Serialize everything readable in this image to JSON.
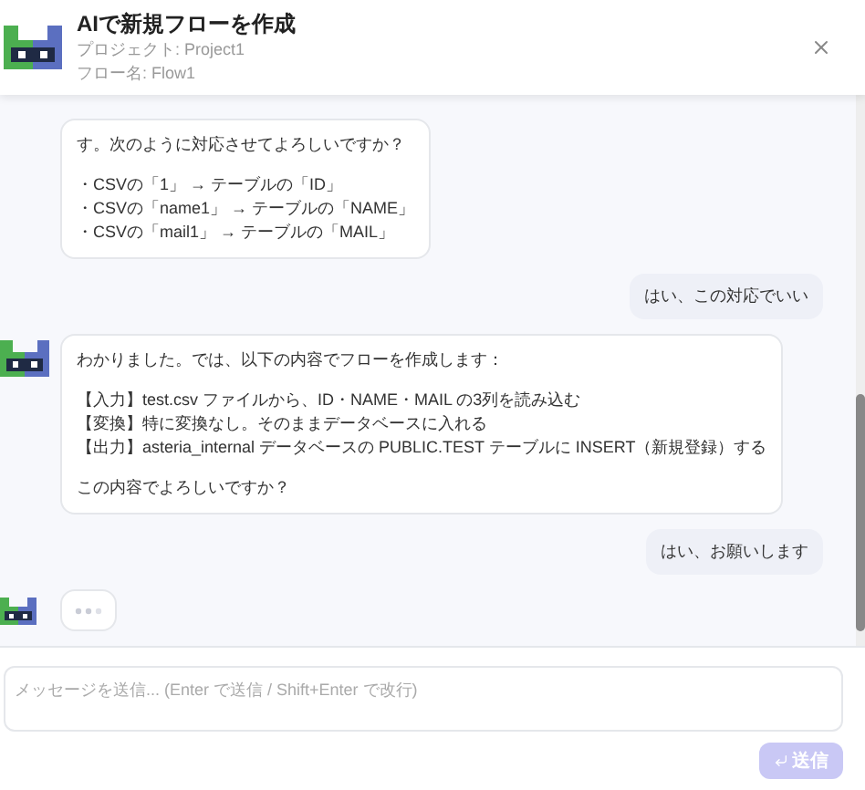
{
  "header": {
    "title": "AIで新規フローを作成",
    "project": "プロジェクト: Project1",
    "flow": "フロー名: Flow1"
  },
  "messages": [
    {
      "kind": "bot",
      "paragraphs": [
        [
          "す。次のように対応させてよろしいですか？"
        ],
        [
          "・CSVの「1」 → テーブルの「ID」",
          "・CSVの「name1」 → テーブルの「NAME」",
          "・CSVの「mail1」 → テーブルの「MAIL」"
        ]
      ],
      "avatar": false
    },
    {
      "kind": "user",
      "paragraphs": [
        [
          "はい、この対応でいい"
        ]
      ]
    },
    {
      "kind": "bot",
      "avatar": true,
      "paragraphs": [
        [
          "わかりました。では、以下の内容でフローを作成します："
        ],
        [
          "【入力】test.csv ファイルから、ID・NAME・MAIL の3列を読み込む",
          "【変換】特に変換なし。そのままデータベースに入れる",
          "【出力】asteria_internal データベースの PUBLIC.TEST テーブルに INSERT（新規登録）する"
        ],
        [
          "この内容でよろしいですか？"
        ]
      ]
    },
    {
      "kind": "user",
      "paragraphs": [
        [
          "はい、お願いします"
        ]
      ]
    },
    {
      "kind": "typing",
      "avatar": true
    }
  ],
  "composer": {
    "placeholder": "メッセージを送信... (Enter で送信 / Shift+Enter で改行)",
    "send_button": {
      "label": "送信",
      "disabled": true
    }
  }
}
